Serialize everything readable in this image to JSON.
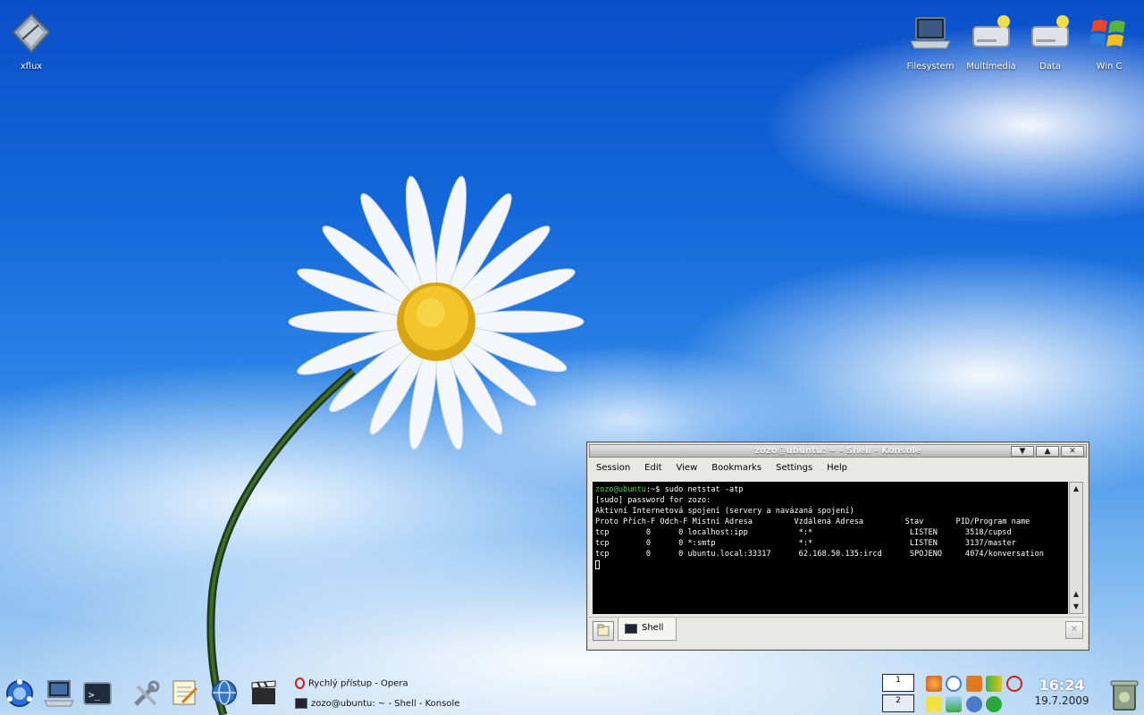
{
  "desktop": {
    "icons": [
      {
        "label": "xflux"
      },
      {
        "label": "Filesystem"
      },
      {
        "label": "Multimedia"
      },
      {
        "label": "Data"
      },
      {
        "label": "Win C"
      }
    ]
  },
  "konsole": {
    "title": "zozo@ubuntu: ~ - Shell - Konsole",
    "menu": [
      "Session",
      "Edit",
      "View",
      "Bookmarks",
      "Settings",
      "Help"
    ],
    "terminal": {
      "prompt": "zozo@ubuntu",
      "prompt_suffix": ":~$ sudo netstat -atp",
      "lines": [
        "[sudo] password for zozo:",
        "Aktivní Internetová spojení (servery a navázaná spojení)",
        "Proto Přích-F Odch-F Místní Adresa         Vzdálená Adresa         Stav       PID/Program name",
        "tcp        0      0 localhost:ipp           *:*                     LISTEN      3518/cupsd",
        "tcp        0      0 *:smtp                  *:*                     LISTEN      3137/master",
        "tcp        0      0 ubuntu.local:33317      62.168.50.135:ircd      SPOJENO     4074/konversation"
      ]
    },
    "tab_label": "Shell",
    "buttons": {
      "minimize": "▼",
      "maximize": "▲",
      "close": "✕"
    }
  },
  "panel": {
    "tasks": [
      {
        "label": "Rychlý přístup - Opera",
        "icon": "opera-icon"
      },
      {
        "label": "zozo@ubuntu: ~ - Shell - Konsole",
        "icon": "konsole-icon"
      }
    ],
    "pager": [
      "1",
      "2"
    ],
    "clock": {
      "time": "16:24",
      "date": "19.7.2009"
    }
  }
}
